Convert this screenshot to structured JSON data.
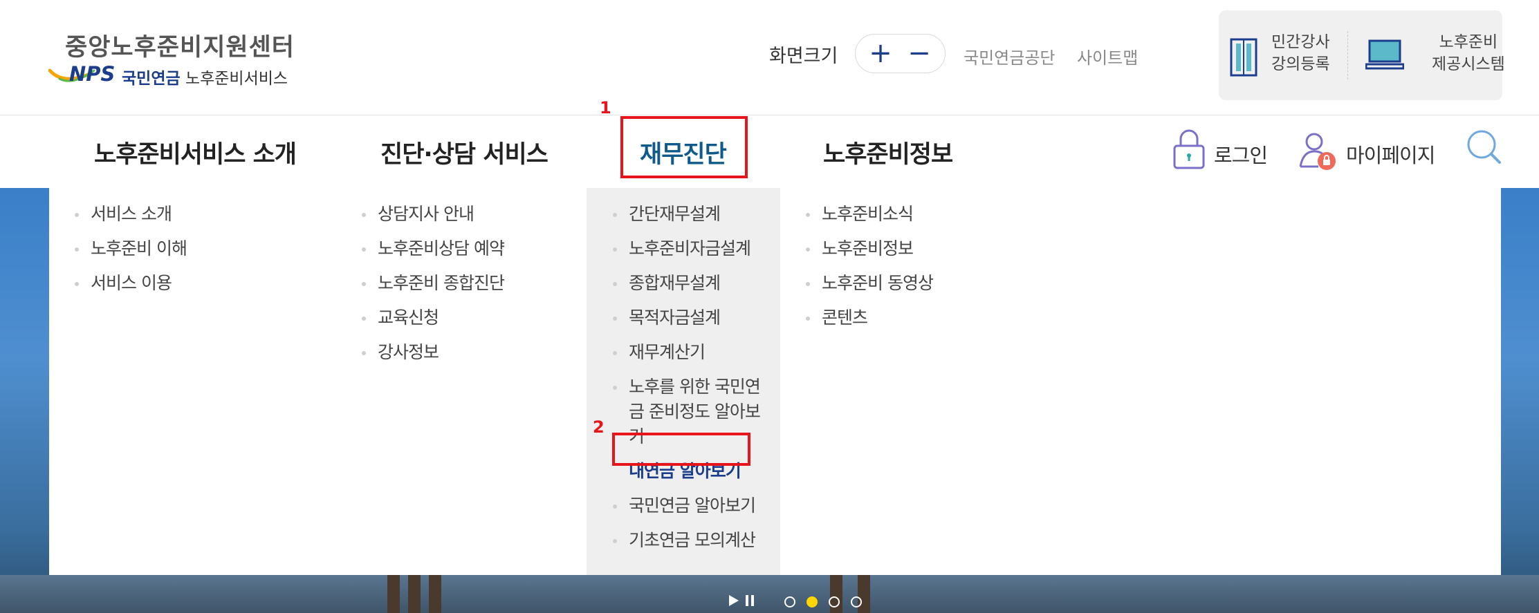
{
  "header": {
    "logo": {
      "title": "중앙노후준비지원센터",
      "nps": "NPS",
      "sub_brand": "국민연금",
      "sub_service": " 노후준비서비스"
    },
    "font_size": {
      "label": "화면크기",
      "plus": "+",
      "minus": "−"
    },
    "util_links": [
      "국민연금공단",
      "사이트맵"
    ],
    "quick_links": [
      {
        "line1": "민간강사",
        "line2": "강의등록",
        "icon": "binder-icon"
      },
      {
        "line1": "노후준비",
        "line2": "제공시스템",
        "icon": "laptop-icon"
      }
    ]
  },
  "gnb": {
    "items": [
      "노후준비서비스 소개",
      "진단·상담 서비스",
      "재무진단",
      "노후준비정보"
    ],
    "active_index": 2,
    "login": "로그인",
    "mypage": "마이페이지",
    "search_icon": "search-icon"
  },
  "annotations": {
    "box1": "1",
    "box2": "2",
    "color": "#e8141c"
  },
  "dropdown": {
    "columns": [
      {
        "items": [
          "서비스 소개",
          "노후준비 이해",
          "서비스 이용"
        ]
      },
      {
        "items": [
          "상담지사 안내",
          "노후준비상담 예약",
          "노후준비 종합진단",
          "교육신청",
          "강사정보"
        ]
      },
      {
        "items": [
          "간단재무설계",
          "노후준비자금설계",
          "종합재무설계",
          "목적자금설계",
          "재무계산기",
          "노후를 위한 국민연금 준비정도 알아보기",
          "내연금 알아보기",
          "국민연금 알아보기",
          "기초연금 모의계산"
        ]
      },
      {
        "items": [
          "노후준비소식",
          "노후준비정보",
          "노후준비 동영상",
          "콘텐츠"
        ]
      }
    ],
    "current_item": "내연금 알아보기"
  },
  "colors": {
    "brand_blue": "#1b3d8c",
    "active_teal": "#0e5a8a",
    "highlight_red": "#e8141c",
    "indicator_yellow": "#ffd600"
  },
  "slider": {
    "dots": 4,
    "active_dot": 1
  }
}
